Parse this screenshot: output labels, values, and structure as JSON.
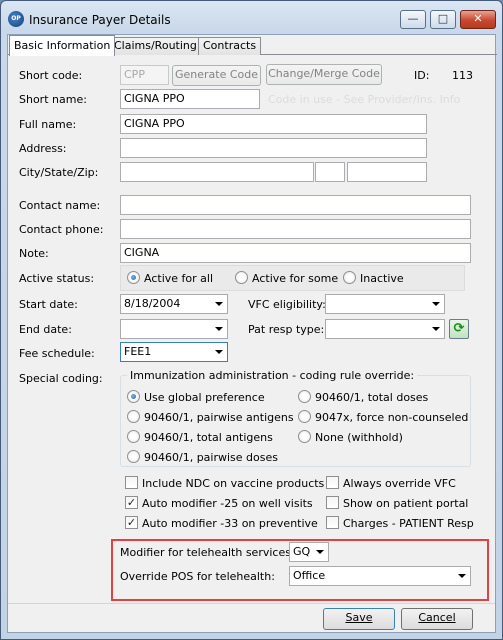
{
  "window": {
    "title": "Insurance Payer Details",
    "app_icon_text": "OP",
    "minimize": "—",
    "maximize": "□",
    "close": "✕"
  },
  "tabs": [
    "Basic Information",
    "Claims/Routing",
    "Contracts"
  ],
  "basic": {
    "short_code_label": "Short code:",
    "short_code_value": "CPP",
    "generate_code": "Generate Code",
    "change_merge_code": "Change/Merge Code",
    "id_label": "ID:",
    "id_value": "113",
    "short_name_label": "Short name:",
    "short_name_value": "CIGNA PPO",
    "code_in_use": "Code in use - See Provider/Ins. Info",
    "full_name_label": "Full name:",
    "full_name_value": "CIGNA PPO",
    "address_label": "Address:",
    "address_value": "",
    "city_label": "City/State/Zip:",
    "city_value": "",
    "state_value": "",
    "zip_value": "",
    "contact_name_label": "Contact name:",
    "contact_name_value": "",
    "contact_phone_label": "Contact phone:",
    "contact_phone_value": "",
    "note_label": "Note:",
    "note_value": "CIGNA",
    "active_status_label": "Active status:",
    "active_options": [
      "Active for all",
      "Active for some",
      "Inactive"
    ],
    "active_selected": 0,
    "start_date_label": "Start date:",
    "start_date_value": "8/18/2004",
    "vfc_label": "VFC eligibility:",
    "vfc_value": "",
    "end_date_label": "End date:",
    "end_date_value": "",
    "pat_resp_label": "Pat resp type:",
    "pat_resp_value": "",
    "fee_schedule_label": "Fee schedule:",
    "fee_schedule_value": "FEE1",
    "special_coding_label": "Special coding:"
  },
  "immunization": {
    "title": "Immunization administration - coding rule override:",
    "options_left": [
      "Use global preference",
      "90460/1, pairwise antigens",
      "90460/1, total antigens",
      "90460/1, pairwise doses"
    ],
    "options_right": [
      "90460/1, total doses",
      "9047x, force non-counseled",
      "None (withhold)"
    ],
    "selected": "Use global preference"
  },
  "checkboxes": {
    "left": [
      {
        "label": "Include NDC on vaccine products",
        "checked": false
      },
      {
        "label": "Auto modifier -25 on well visits",
        "checked": true
      },
      {
        "label": "Auto modifier -33 on preventive",
        "checked": true
      }
    ],
    "right": [
      {
        "label": "Always override VFC",
        "checked": false
      },
      {
        "label": "Show on patient portal",
        "checked": false
      },
      {
        "label": "Charges - PATIENT Resp",
        "checked": false
      }
    ]
  },
  "telehealth": {
    "modifier_label": "Modifier for telehealth services:",
    "modifier_value": "GQ",
    "pos_label": "Override POS for telehealth:",
    "pos_value": "Office"
  },
  "footer": {
    "save": "Save",
    "cancel": "Cancel"
  },
  "colors": {
    "highlight": "#e04242",
    "titlebar": "#c9d8ea"
  }
}
